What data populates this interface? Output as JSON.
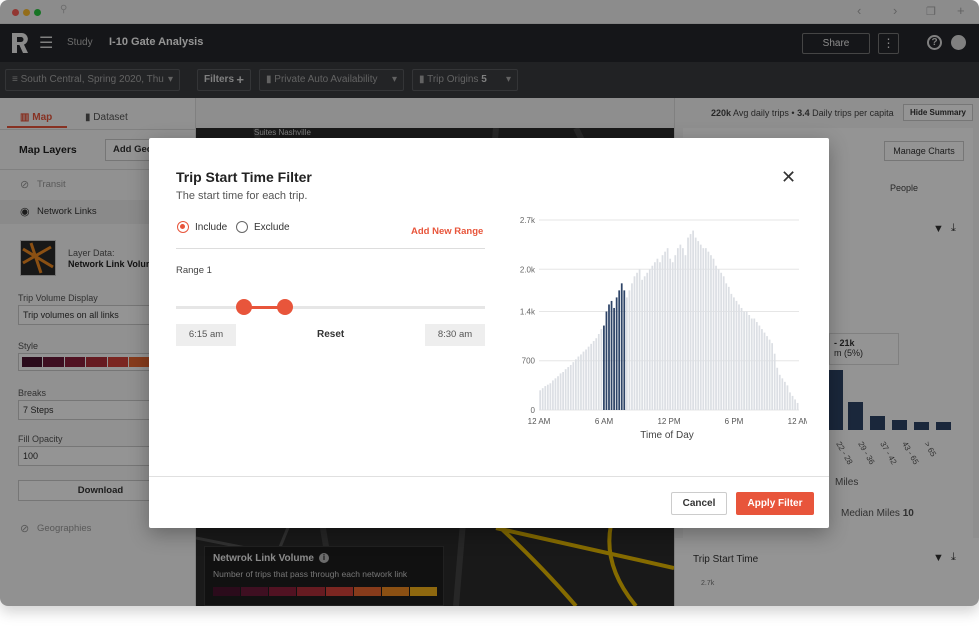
{
  "header": {
    "crumb": "Study",
    "title": "I-10 Gate Analysis",
    "share_label": "Share",
    "more_label": "⋮",
    "help_label": "?"
  },
  "toolbar": {
    "scenario": "South Central, Spring 2020, Thu",
    "filters": "Filters",
    "private_auto": "Private Auto Availability",
    "trip_origins": "Trip Origins",
    "trip_origins_count": "5"
  },
  "summary": {
    "avg_trips_value": "220k",
    "avg_trips_label": "Avg daily trips •",
    "per_capita_value": "3.4",
    "per_capita_label": "Daily trips per capita",
    "hide_label": "Hide Summary",
    "manage_label": "Manage Charts",
    "people_label": "People",
    "tooltip_range": "- 21k",
    "tooltip_pct": "m (5%)",
    "miles_label": "Miles",
    "median_label": "Median Miles",
    "median_value": "10",
    "trip_start_label": "Trip Start Time",
    "trip_start_tick": "2.7k",
    "bin_labels": [
      "22 - 28",
      "29 - 36",
      "37 - 42",
      "43 - 65",
      "> 65"
    ]
  },
  "left": {
    "tab_map": "Map",
    "tab_dataset": "Dataset",
    "map_layers": "Map Layers",
    "add_geo": "Add Geo",
    "transit": "Transit",
    "network_links": "Network Links",
    "layer_data_label": "Layer Data:",
    "layer_data_value": "Network Link Volum",
    "trip_volume_display": "Trip Volume Display",
    "trip_volume_value": "Trip volumes on all links",
    "style_label": "Style",
    "breaks_label": "Breaks",
    "breaks_value": "7 Steps",
    "fill_opacity_label": "Fill Opacity",
    "fill_opacity_value": "100",
    "download_label": "Download",
    "geographies": "Geographies"
  },
  "map": {
    "suite_label": "Suites Nashville",
    "legend_title": "Netwrok Link Volume",
    "legend_sub": "Number of trips that pass through each network link",
    "legend_colors": [
      "#4a1430",
      "#6b1a3a",
      "#8c1f3c",
      "#b02f3a",
      "#d4433a",
      "#e8672f",
      "#f08a22",
      "#f4b31a"
    ]
  },
  "modal": {
    "title": "Trip Start Time Filter",
    "subtitle": "The start time for each trip.",
    "include_label": "Include",
    "exclude_label": "Exclude",
    "add_range_label": "Add New Range",
    "range_label": "Range 1",
    "start_time": "6:15 am",
    "end_time": "8:30 am",
    "reset_label": "Reset",
    "cancel_label": "Cancel",
    "apply_label": "Apply Filter",
    "close_icon": "close-icon"
  },
  "chart_data": {
    "type": "bar",
    "xlabel": "Time of Day",
    "ylabel": "",
    "ylim": [
      0,
      2700
    ],
    "yticks": [
      "0",
      "700",
      "1.4k",
      "2.0k",
      "2.7k"
    ],
    "ytick_values": [
      0,
      700,
      1400,
      2000,
      2700
    ],
    "xticks": [
      "12 AM",
      "6 AM",
      "12 PM",
      "6 PM",
      "12 AM"
    ],
    "xtick_hours": [
      0,
      6,
      12,
      18,
      24
    ],
    "bin_minutes": 15,
    "selected_range_bins": [
      25,
      33
    ],
    "selected_color": "#2e4467",
    "unselected_color": "#dcdfe4",
    "values": [
      280,
      310,
      340,
      360,
      380,
      420,
      450,
      480,
      520,
      540,
      580,
      610,
      640,
      680,
      720,
      760,
      790,
      830,
      860,
      900,
      940,
      980,
      1020,
      1080,
      1150,
      1200,
      1400,
      1500,
      1550,
      1450,
      1600,
      1700,
      1800,
      1700,
      1600,
      1700,
      1800,
      1900,
      1950,
      2000,
      1850,
      1900,
      1950,
      2000,
      2050,
      2100,
      2150,
      2100,
      2200,
      2250,
      2300,
      2150,
      2100,
      2200,
      2300,
      2350,
      2300,
      2200,
      2450,
      2500,
      2550,
      2450,
      2400,
      2350,
      2300,
      2300,
      2250,
      2200,
      2150,
      2050,
      2000,
      1950,
      1900,
      1800,
      1750,
      1650,
      1600,
      1550,
      1500,
      1450,
      1400,
      1400,
      1350,
      1300,
      1300,
      1250,
      1200,
      1150,
      1100,
      1050,
      1000,
      950,
      800,
      600,
      500,
      450,
      400,
      350,
      250,
      200,
      150,
      100
    ]
  }
}
